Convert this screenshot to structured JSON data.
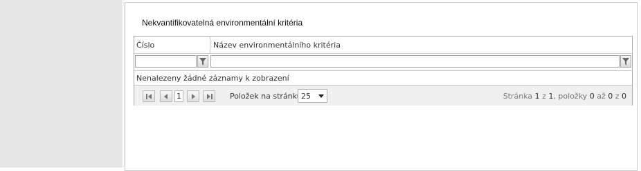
{
  "section": {
    "title": "Nekvantifikovatelná environmentální kritéria"
  },
  "grid": {
    "columns": [
      "Číslo",
      "Název environmentálního kritéria"
    ],
    "filters": [
      {
        "value": "",
        "icon": "filter-icon"
      },
      {
        "value": "",
        "icon": "filter-icon"
      }
    ],
    "empty_message": "Nenalezeny žádné záznamy k zobrazení"
  },
  "pager": {
    "current_page": "1",
    "per_page_label": "Položek na stránku",
    "per_page_value": "25",
    "info_prefix": "Stránka",
    "page": "1",
    "of_word": "z",
    "total_pages": "1",
    "items_word": ", položky",
    "from": "0",
    "to_word": "až",
    "to": "0",
    "total_items": "0",
    "icons": [
      "first-page-icon",
      "prev-page-icon",
      "next-page-icon",
      "last-page-icon"
    ]
  }
}
